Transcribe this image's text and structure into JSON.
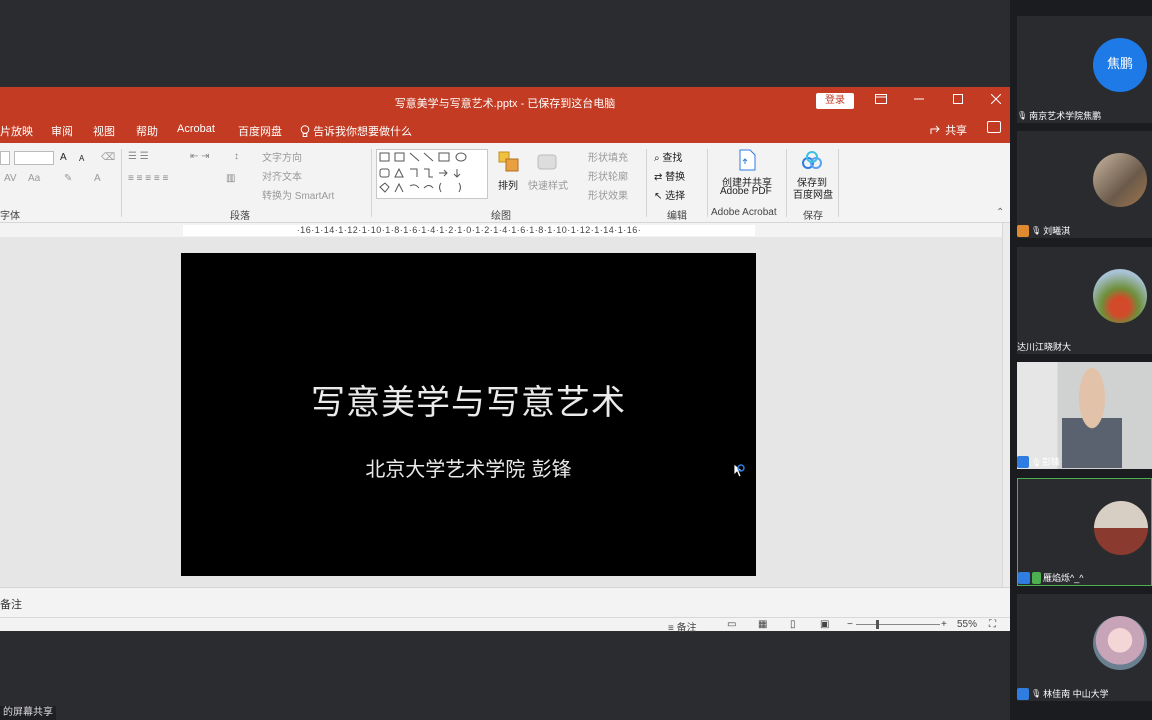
{
  "window": {
    "title": "写意美学与写意艺术.pptx - 已保存到这台电脑",
    "login_label": "登录"
  },
  "tabs": [
    {
      "label": "片放映"
    },
    {
      "label": "审阅"
    },
    {
      "label": "视图"
    },
    {
      "label": "帮助"
    },
    {
      "label": "Acrobat"
    },
    {
      "label": "百度网盘"
    },
    {
      "label": "告诉我你想要做什么"
    }
  ],
  "share_label": "共享",
  "ribbon": {
    "font_group": "字体",
    "font_buttons": {
      "grow": "A",
      "shrink": "A",
      "aa": "Aa"
    },
    "paragraph_group": "段落",
    "text_direction": "文字方向",
    "align_text": "对齐文本",
    "convert_smartart": "转换为 SmartArt",
    "drawing_group": "绘图",
    "arrange": "排列",
    "quick_styles": "快速样式",
    "shape_fill": "形状填充",
    "shape_outline": "形状轮廓",
    "shape_effects": "形状效果",
    "edit_group": "编辑",
    "find": "查找",
    "replace": "替换",
    "select": "选择",
    "acrobat_line1": "创建并共享",
    "acrobat_line2": "Adobe PDF",
    "acrobat_group": "Adobe Acrobat",
    "baidu_line1": "保存到",
    "baidu_line2": "百度网盘",
    "save_group": "保存"
  },
  "ruler_text": "·16·1·14·1·12·1·10·1·8·1·6·1·4·1·2·1·0·1·2·1·4·1·6·1·8·1·10·1·12·1·14·1·16·",
  "slide": {
    "title": "写意美学与写意艺术",
    "subtitle": "北京大学艺术学院 彭锋"
  },
  "notes_label": "备注",
  "status": {
    "notes": "备注",
    "zoom": "55%"
  },
  "share_tag": "的屏幕共享",
  "participants": [
    {
      "name": "南京艺术学院焦鹏",
      "avatar_text": "焦鹏"
    },
    {
      "name": "刘曦淇"
    },
    {
      "name": "达川江晓财大"
    },
    {
      "name": "彭锋"
    },
    {
      "name": "雁焰烁^_^"
    },
    {
      "name": "林佳南 中山大学"
    }
  ],
  "colors": {
    "ppt_red": "#c23b22",
    "host_blue": "#2f7de1",
    "mic_green": "#4caf50",
    "active_border": "#4caf50"
  }
}
